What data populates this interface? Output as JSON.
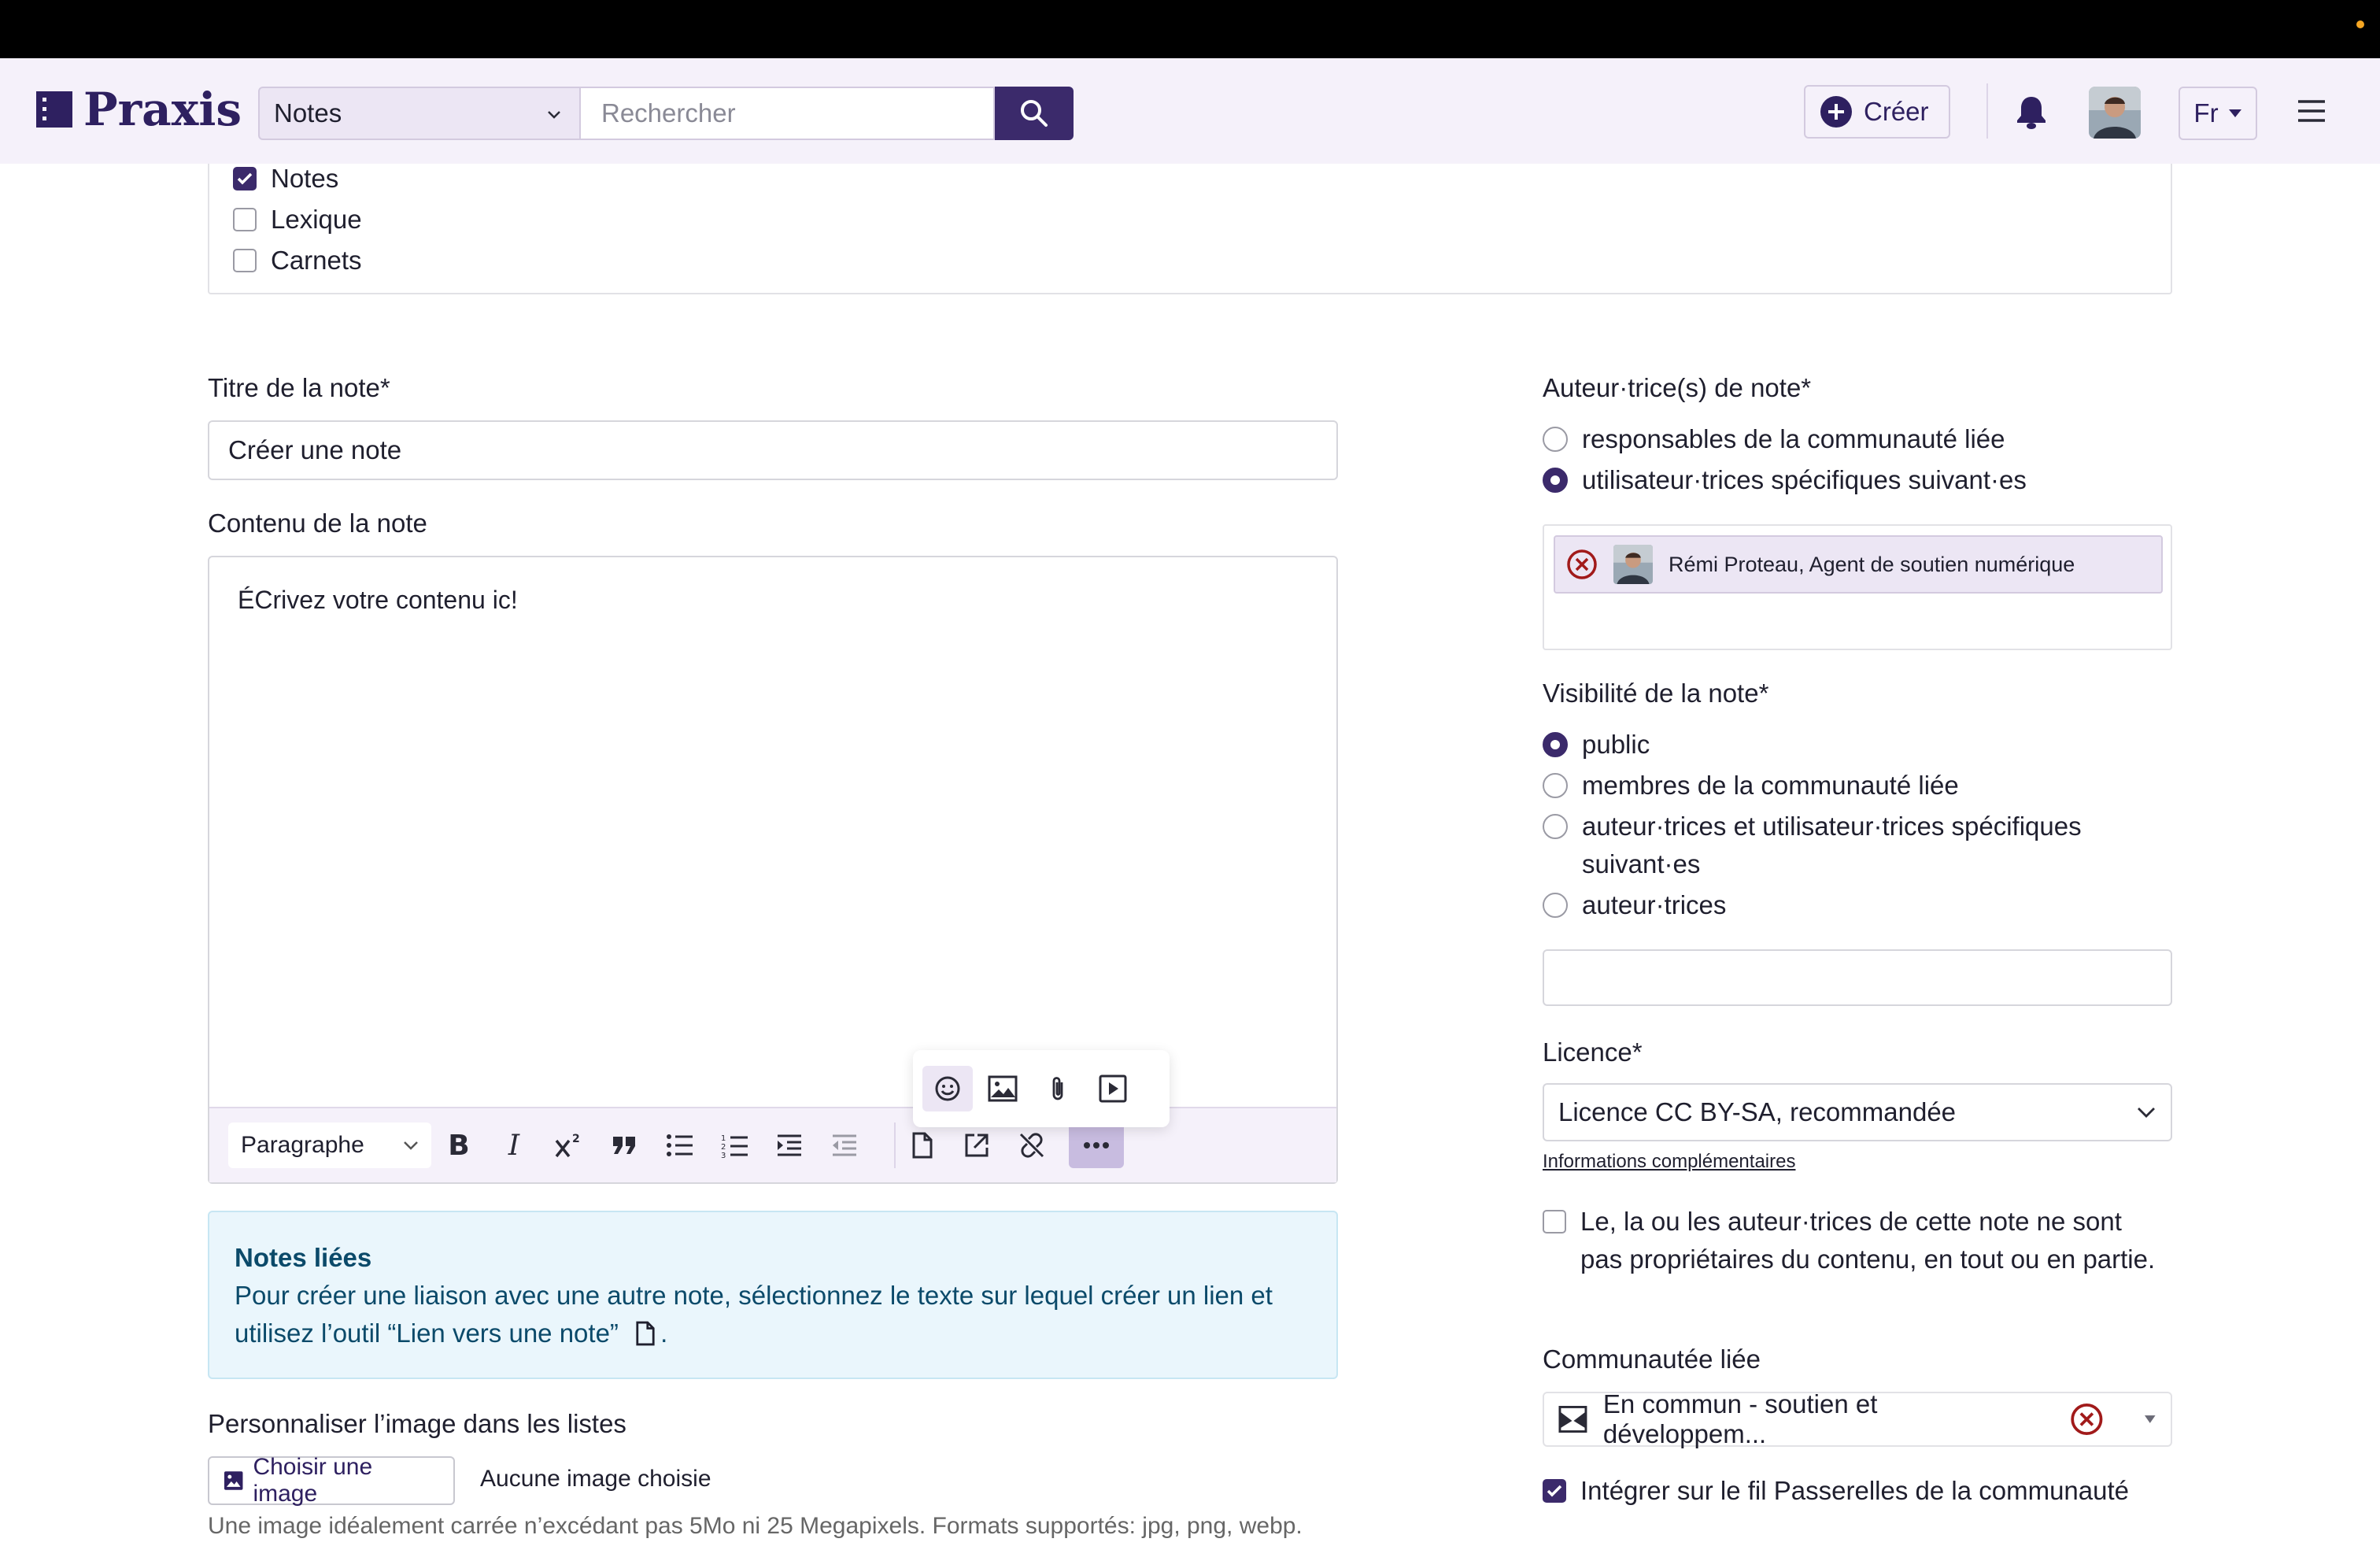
{
  "header": {
    "logo_text": "Praxis",
    "scope_select": "Notes",
    "search_placeholder": "Rechercher",
    "create_label": "Créer",
    "language": "Fr"
  },
  "content_types": [
    {
      "label": "Notes",
      "checked": true
    },
    {
      "label": "Lexique",
      "checked": false
    },
    {
      "label": "Carnets",
      "checked": false
    }
  ],
  "form": {
    "title_label": "Titre de la note*",
    "title_value": "Créer une note",
    "content_label": "Contenu de la note",
    "content_value": "ÉCrivez votre contenu ic!",
    "paragraph_select": "Paragraphe",
    "linked_notes": {
      "title": "Notes liées",
      "body": "Pour créer une liaison avec une autre note, sélectionnez le texte sur lequel créer un lien et utilisez l’outil “Lien vers une note”",
      "end": "."
    },
    "image_label": "Personnaliser l’image dans les listes",
    "choose_image": "Choisir une image",
    "no_image": "Aucune image choisie",
    "image_hint": "Une image idéalement carrée n’excédant pas 5Mo ni 25 Megapixels. Formats supportés: jpg, png, webp."
  },
  "authors": {
    "label": "Auteur·trice(s) de note*",
    "options": [
      {
        "label": "responsables de la communauté liée",
        "selected": false
      },
      {
        "label": "utilisateur·trices spécifiques suivant·es",
        "selected": true
      }
    ],
    "chip": "Rémi Proteau, Agent de soutien numérique"
  },
  "visibility": {
    "label": "Visibilité de la note*",
    "options": [
      {
        "label": "public",
        "selected": true
      },
      {
        "label": "membres de la communauté liée",
        "selected": false
      },
      {
        "label": "auteur·trices et utilisateur·trices spécifiques suivant·es",
        "selected": false
      },
      {
        "label": "auteur·trices",
        "selected": false
      }
    ]
  },
  "license": {
    "label": "Licence*",
    "value": "Licence CC BY-SA, recommandée",
    "more_info": "Informations complémentaires",
    "not_owner": "Le, la ou les auteur·trices de cette note ne sont pas propriétaires du contenu, en tout ou en partie."
  },
  "community": {
    "label": "Communautée liée",
    "value": "En commun - soutien et développem...",
    "integrate": "Intégrer sur le fil Passerelles de la communauté",
    "integrate_checked": true
  },
  "colors": {
    "brand": "#3b2a6b",
    "header_bg": "#f5f1fa",
    "info_bg": "#eaf6fc"
  }
}
